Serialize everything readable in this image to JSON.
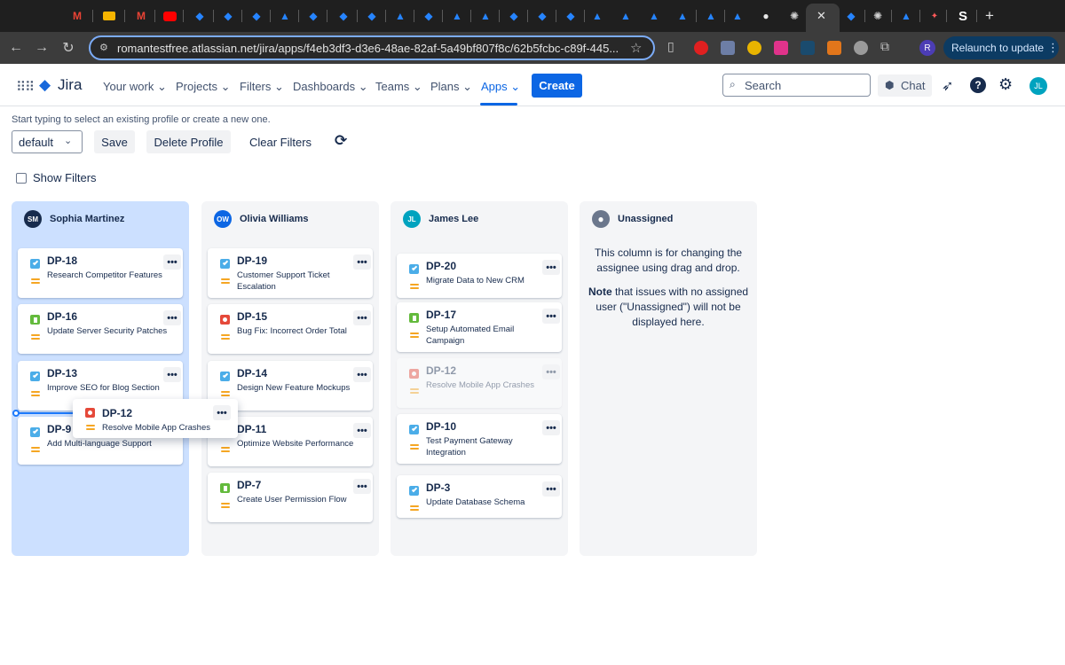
{
  "browser": {
    "url": "romantestfree.atlassian.net/jira/apps/f4eb3df3-d3e6-48ae-82af-5a49bf807f8c/62b5fcbc-c89f-445...",
    "relaunch_label": "Relaunch to update",
    "profile_initial": "R",
    "close_glyph": "✕",
    "new_tab_glyph": "+"
  },
  "nav": {
    "logo": "Jira",
    "items": [
      "Your work",
      "Projects",
      "Filters",
      "Dashboards",
      "Teams",
      "Plans",
      "Apps"
    ],
    "create_label": "Create",
    "search_placeholder": "Search",
    "chat_label": "Chat",
    "user_initials": "JL"
  },
  "profile": {
    "hint": "Start typing to select an existing profile or create a new one.",
    "selected": "default",
    "save_label": "Save",
    "delete_label": "Delete Profile",
    "clear_label": "Clear Filters",
    "show_filters_label": "Show Filters"
  },
  "columns": [
    {
      "name": "Sophia Martinez",
      "initials": "SM",
      "cards": [
        {
          "key": "DP-18",
          "title": "Research Competitor Features",
          "type": "task"
        },
        {
          "key": "DP-16",
          "title": "Update Server Security Patches",
          "type": "story"
        },
        {
          "key": "DP-13",
          "title": "Improve SEO for Blog Section",
          "type": "task"
        },
        {
          "key": "DP-9",
          "title": "Add Multi-language Support",
          "type": "task"
        }
      ]
    },
    {
      "name": "Olivia Williams",
      "initials": "OW",
      "cards": [
        {
          "key": "DP-19",
          "title": "Customer Support Ticket Escalation",
          "type": "task"
        },
        {
          "key": "DP-15",
          "title": "Bug Fix: Incorrect Order Total",
          "type": "bug"
        },
        {
          "key": "DP-14",
          "title": "Design New Feature Mockups",
          "type": "task"
        },
        {
          "key": "DP-11",
          "title": "Optimize Website Performance",
          "type": "task"
        },
        {
          "key": "DP-7",
          "title": "Create User Permission Flow",
          "type": "story"
        }
      ]
    },
    {
      "name": "James Lee",
      "initials": "JL",
      "cards": [
        {
          "key": "DP-20",
          "title": "Migrate Data to New CRM",
          "type": "task"
        },
        {
          "key": "DP-17",
          "title": "Setup Automated Email Campaign",
          "type": "story"
        },
        {
          "key": "DP-12",
          "title": "Resolve Mobile App Crashes",
          "type": "bug"
        },
        {
          "key": "DP-10",
          "title": "Test Payment Gateway Integration",
          "type": "task"
        },
        {
          "key": "DP-3",
          "title": "Update Database Schema",
          "type": "task"
        }
      ]
    },
    {
      "name": "Unassigned",
      "text_1": "This column is for changing the assignee using drag and drop.",
      "text_note_bold": "Note",
      "text_note": " that issues with no assigned user (\"Unassigned\") will not be displayed here."
    }
  ],
  "dragging": {
    "key": "DP-12",
    "title": "Resolve Mobile App Crashes",
    "type": "bug"
  },
  "colors": {
    "accent": "#0c66e4",
    "task": "#4bade8",
    "story": "#63ba3c",
    "bug": "#e5493a",
    "priority": "#f5a623",
    "drop_zone": "#cce0ff"
  }
}
